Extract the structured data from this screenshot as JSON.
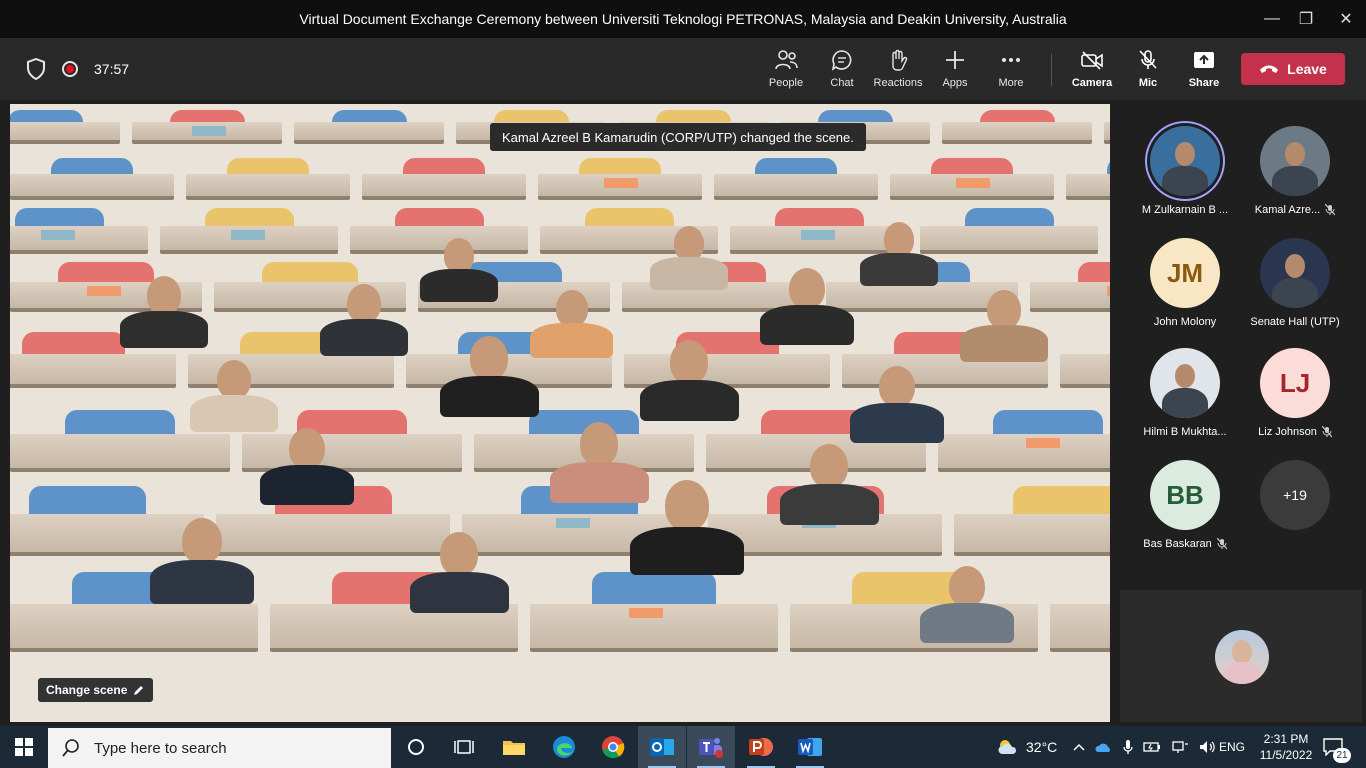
{
  "window": {
    "title": "Virtual Document Exchange Ceremony between Universiti Teknologi PETRONAS, Malaysia and Deakin University, Australia",
    "minimize": "—",
    "maximize": "❐",
    "close": "✕"
  },
  "meeting": {
    "timer": "37:57",
    "buttons": {
      "people": "People",
      "chat": "Chat",
      "reactions": "Reactions",
      "apps": "Apps",
      "more": "More",
      "camera": "Camera",
      "mic": "Mic",
      "share": "Share"
    },
    "leave": "Leave",
    "toast": "Kamal Azreel B Kamarudin (CORP/UTP) changed the scene.",
    "change_scene": "Change scene"
  },
  "participants": [
    {
      "name": "M Zulkarnain B ...",
      "initials": "",
      "photo": true,
      "muted": false,
      "speaking": true,
      "bg": "#3a6e9c"
    },
    {
      "name": "Kamal Azre...",
      "initials": "",
      "photo": true,
      "muted": true,
      "speaking": false,
      "bg": "#6c7a85"
    },
    {
      "name": "John Molony",
      "initials": "JM",
      "photo": false,
      "muted": false,
      "speaking": false,
      "bg": "#f8e6c5",
      "fg": "#8a5a10"
    },
    {
      "name": "Senate Hall (UTP)",
      "initials": "",
      "photo": true,
      "muted": false,
      "speaking": false,
      "bg": "#2a3550"
    },
    {
      "name": "Hilmi B Mukhta...",
      "initials": "",
      "photo": true,
      "muted": false,
      "speaking": false,
      "bg": "#dfe5ea"
    },
    {
      "name": "Liz Johnson",
      "initials": "LJ",
      "photo": false,
      "muted": true,
      "speaking": false,
      "bg": "#fbdcd9",
      "fg": "#a4262c"
    },
    {
      "name": "Bas Baskaran",
      "initials": "BB",
      "photo": false,
      "muted": true,
      "speaking": false,
      "bg": "#dcebe0",
      "fg": "#255c3a"
    },
    {
      "name": "",
      "initials": "+19",
      "photo": false,
      "muted": false,
      "speaking": false,
      "bg": "#3b3b3b",
      "fg": "#ffffff"
    }
  ],
  "taskbar": {
    "search_placeholder": "Type here to search",
    "weather": "32°C",
    "language": "ENG",
    "time": "2:31 PM",
    "date": "11/5/2022",
    "notifications": "21"
  }
}
